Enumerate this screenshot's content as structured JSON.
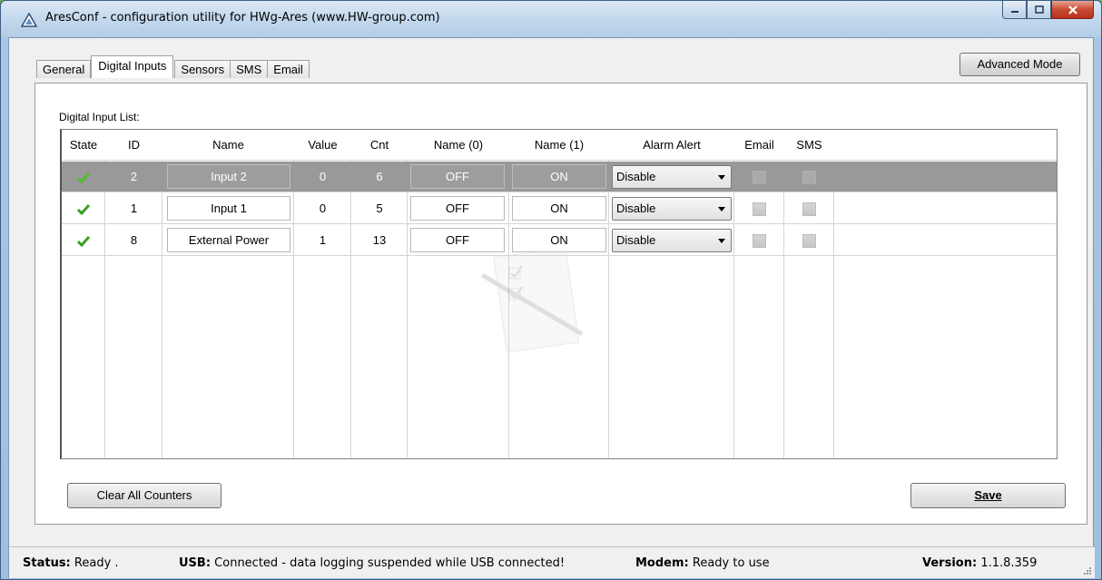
{
  "window": {
    "title": "AresConf - configuration utility for HWg-Ares (www.HW-group.com)"
  },
  "tabs": [
    {
      "label": "General"
    },
    {
      "label": "Digital Inputs",
      "active": true
    },
    {
      "label": "Sensors"
    },
    {
      "label": "SMS"
    },
    {
      "label": "Email"
    }
  ],
  "advanced_mode_label": "Advanced Mode",
  "list_label": "Digital Input List:",
  "columns": [
    "State",
    "ID",
    "Name",
    "Value",
    "Cnt",
    "Name (0)",
    "Name (1)",
    "Alarm Alert",
    "Email",
    "SMS"
  ],
  "rows": [
    {
      "state": "ok",
      "id": "2",
      "name": "Input 2",
      "value": "0",
      "cnt": "6",
      "name0": "OFF",
      "name1": "ON",
      "alarm": "Disable",
      "email": false,
      "sms": false,
      "selected": true
    },
    {
      "state": "ok",
      "id": "1",
      "name": "Input 1",
      "value": "0",
      "cnt": "5",
      "name0": "OFF",
      "name1": "ON",
      "alarm": "Disable",
      "email": false,
      "sms": false,
      "selected": false
    },
    {
      "state": "ok",
      "id": "8",
      "name": "External Power",
      "value": "1",
      "cnt": "13",
      "name0": "OFF",
      "name1": "ON",
      "alarm": "Disable",
      "email": false,
      "sms": false,
      "selected": false
    }
  ],
  "buttons": {
    "clear_counters": "Clear All Counters",
    "save": "Save"
  },
  "status": {
    "status_label": "Status:",
    "status_value": "Ready .",
    "usb_label": "USB:",
    "usb_value": "Connected - data logging suspended while USB connected!",
    "modem_label": "Modem:",
    "modem_value": "Ready to use",
    "version_label": "Version:",
    "version_value": "1.1.8.359"
  },
  "colors": {
    "selected_row": "#999999",
    "check_green": "#3aa024"
  }
}
